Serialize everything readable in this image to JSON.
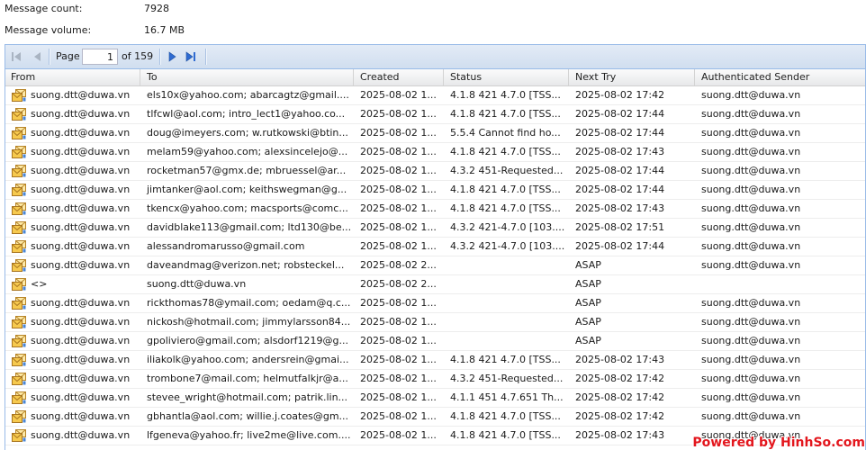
{
  "summary": {
    "message_count_label": "Message count:",
    "message_count": "7928",
    "message_volume_label": "Message volume:",
    "message_volume": "16.7 MB"
  },
  "pager": {
    "first": {
      "icon": "first-page-icon",
      "enabled": false
    },
    "prev": {
      "icon": "prev-page-icon",
      "enabled": false
    },
    "page_label": "Page",
    "current_page": "1",
    "of_label": "of",
    "total_pages": "159",
    "next": {
      "icon": "next-page-icon",
      "enabled": true
    },
    "last": {
      "icon": "last-page-icon",
      "enabled": true
    }
  },
  "columns": [
    "From",
    "To",
    "Created",
    "Status",
    "Next Try",
    "Authenticated Sender"
  ],
  "row_icon": "mail-envelope-icon",
  "rows": [
    {
      "from": "suong.dtt@duwa.vn",
      "to": "els10x@yahoo.com; abarcagtz@gmail....",
      "created": "2025-08-02 1...",
      "status": "4.1.8 421 4.7.0 [TSS...",
      "next_try": "2025-08-02 17:42",
      "auth_sender": "suong.dtt@duwa.vn"
    },
    {
      "from": "suong.dtt@duwa.vn",
      "to": "tlfcwl@aol.com; intro_lect1@yahoo.co...",
      "created": "2025-08-02 1...",
      "status": "4.1.8 421 4.7.0 [TSS...",
      "next_try": "2025-08-02 17:44",
      "auth_sender": "suong.dtt@duwa.vn"
    },
    {
      "from": "suong.dtt@duwa.vn",
      "to": "doug@imeyers.com; w.rutkowski@btin...",
      "created": "2025-08-02 1...",
      "status": "5.5.4 Cannot find ho...",
      "next_try": "2025-08-02 17:44",
      "auth_sender": "suong.dtt@duwa.vn"
    },
    {
      "from": "suong.dtt@duwa.vn",
      "to": "melam59@yahoo.com; alexsincelejo@...",
      "created": "2025-08-02 1...",
      "status": "4.1.8 421 4.7.0 [TSS...",
      "next_try": "2025-08-02 17:43",
      "auth_sender": "suong.dtt@duwa.vn"
    },
    {
      "from": "suong.dtt@duwa.vn",
      "to": "rocketman57@gmx.de; mbruessel@ar...",
      "created": "2025-08-02 1...",
      "status": "4.3.2 451-Requested...",
      "next_try": "2025-08-02 17:44",
      "auth_sender": "suong.dtt@duwa.vn"
    },
    {
      "from": "suong.dtt@duwa.vn",
      "to": "jimtanker@aol.com; keithswegman@g...",
      "created": "2025-08-02 1...",
      "status": "4.1.8 421 4.7.0 [TSS...",
      "next_try": "2025-08-02 17:44",
      "auth_sender": "suong.dtt@duwa.vn"
    },
    {
      "from": "suong.dtt@duwa.vn",
      "to": "tkencx@yahoo.com; macsports@comc...",
      "created": "2025-08-02 1...",
      "status": "4.1.8 421 4.7.0 [TSS...",
      "next_try": "2025-08-02 17:43",
      "auth_sender": "suong.dtt@duwa.vn"
    },
    {
      "from": "suong.dtt@duwa.vn",
      "to": "davidblake113@gmail.com; ltd130@be...",
      "created": "2025-08-02 1...",
      "status": "4.3.2 421-4.7.0 [103....",
      "next_try": "2025-08-02 17:51",
      "auth_sender": "suong.dtt@duwa.vn"
    },
    {
      "from": "suong.dtt@duwa.vn",
      "to": "alessandromarusso@gmail.com",
      "created": "2025-08-02 1...",
      "status": "4.3.2 421-4.7.0 [103....",
      "next_try": "2025-08-02 17:44",
      "auth_sender": "suong.dtt@duwa.vn"
    },
    {
      "from": "suong.dtt@duwa.vn",
      "to": "daveandmag@verizon.net; robsteckel...",
      "created": "2025-08-02 2...",
      "status": "",
      "next_try": "ASAP",
      "auth_sender": "suong.dtt@duwa.vn"
    },
    {
      "from": "<>",
      "to": "suong.dtt@duwa.vn",
      "created": "2025-08-02 2...",
      "status": "",
      "next_try": "ASAP",
      "auth_sender": ""
    },
    {
      "from": "suong.dtt@duwa.vn",
      "to": "rickthomas78@ymail.com; oedam@q.c...",
      "created": "2025-08-02 1...",
      "status": "",
      "next_try": "ASAP",
      "auth_sender": "suong.dtt@duwa.vn"
    },
    {
      "from": "suong.dtt@duwa.vn",
      "to": "nickosh@hotmail.com; jimmylarsson84...",
      "created": "2025-08-02 1...",
      "status": "",
      "next_try": "ASAP",
      "auth_sender": "suong.dtt@duwa.vn"
    },
    {
      "from": "suong.dtt@duwa.vn",
      "to": "gpoliviero@gmail.com; alsdorf1219@g...",
      "created": "2025-08-02 1...",
      "status": "",
      "next_try": "ASAP",
      "auth_sender": "suong.dtt@duwa.vn"
    },
    {
      "from": "suong.dtt@duwa.vn",
      "to": "iliakolk@yahoo.com; andersrein@gmai...",
      "created": "2025-08-02 1...",
      "status": "4.1.8 421 4.7.0 [TSS...",
      "next_try": "2025-08-02 17:43",
      "auth_sender": "suong.dtt@duwa.vn"
    },
    {
      "from": "suong.dtt@duwa.vn",
      "to": "trombone7@mail.com; helmutfalkjr@a...",
      "created": "2025-08-02 1...",
      "status": "4.3.2 451-Requested...",
      "next_try": "2025-08-02 17:42",
      "auth_sender": "suong.dtt@duwa.vn"
    },
    {
      "from": "suong.dtt@duwa.vn",
      "to": "stevee_wright@hotmail.com; patrik.lin...",
      "created": "2025-08-02 1...",
      "status": "4.1.1 451 4.7.651 Th...",
      "next_try": "2025-08-02 17:42",
      "auth_sender": "suong.dtt@duwa.vn"
    },
    {
      "from": "suong.dtt@duwa.vn",
      "to": "gbhantla@aol.com; willie.j.coates@gm...",
      "created": "2025-08-02 1...",
      "status": "4.1.8 421 4.7.0 [TSS...",
      "next_try": "2025-08-02 17:42",
      "auth_sender": "suong.dtt@duwa.vn"
    },
    {
      "from": "suong.dtt@duwa.vn",
      "to": "lfgeneva@yahoo.fr; live2me@live.com....",
      "created": "2025-08-02 1...",
      "status": "4.1.8 421 4.7.0 [TSS...",
      "next_try": "2025-08-02 17:43",
      "auth_sender": "suong.dtt@duwa.vn"
    }
  ],
  "watermark": "Powered by HinhSo.com",
  "colors": {
    "grid_border": "#99bbe8",
    "toolbar_top": "#e3ebf6",
    "toolbar_bottom": "#d0deef",
    "pager_active": "#2f6bd1",
    "pager_disabled": "#a9b4c2",
    "watermark": "#e3161d"
  }
}
